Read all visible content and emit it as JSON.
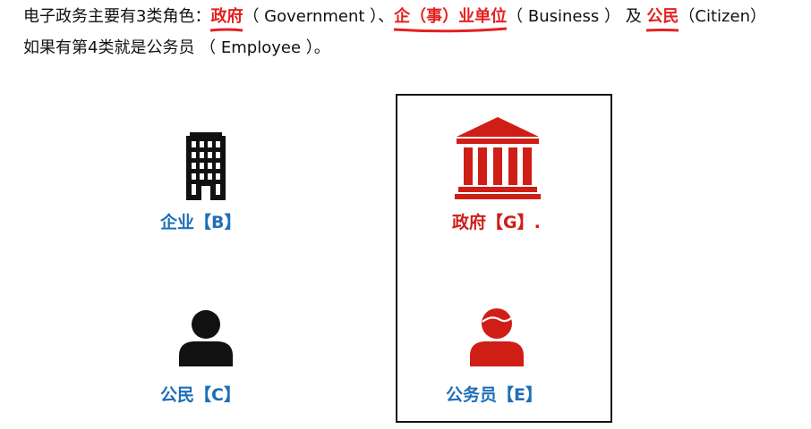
{
  "colors": {
    "accent": "#e3211f",
    "blue_label": "#1e6fb8",
    "red_label": "#cf1e16",
    "icon_black": "#111111",
    "icon_red": "#cf1e16"
  },
  "intro": {
    "line1": {
      "prefix": "电子政务主要有3类角色：",
      "role_g": "政府",
      "role_g_en": "（ Government ）、",
      "role_b": "企（事）业单位",
      "role_b_en": "（ Business ） 及 ",
      "role_c": "公民",
      "role_c_en": "（Citizen）"
    },
    "line2": "如果有第4类就是公务员 （ Employee ）。"
  },
  "roles": {
    "business": {
      "label": "企业【B】",
      "icon": "office-building-icon"
    },
    "government": {
      "label": "政府【G】.",
      "icon": "government-building-icon"
    },
    "citizen": {
      "label": "公民【C】",
      "icon": "person-icon"
    },
    "employee": {
      "label": "公务员【E】",
      "icon": "civil-servant-person-icon"
    }
  }
}
